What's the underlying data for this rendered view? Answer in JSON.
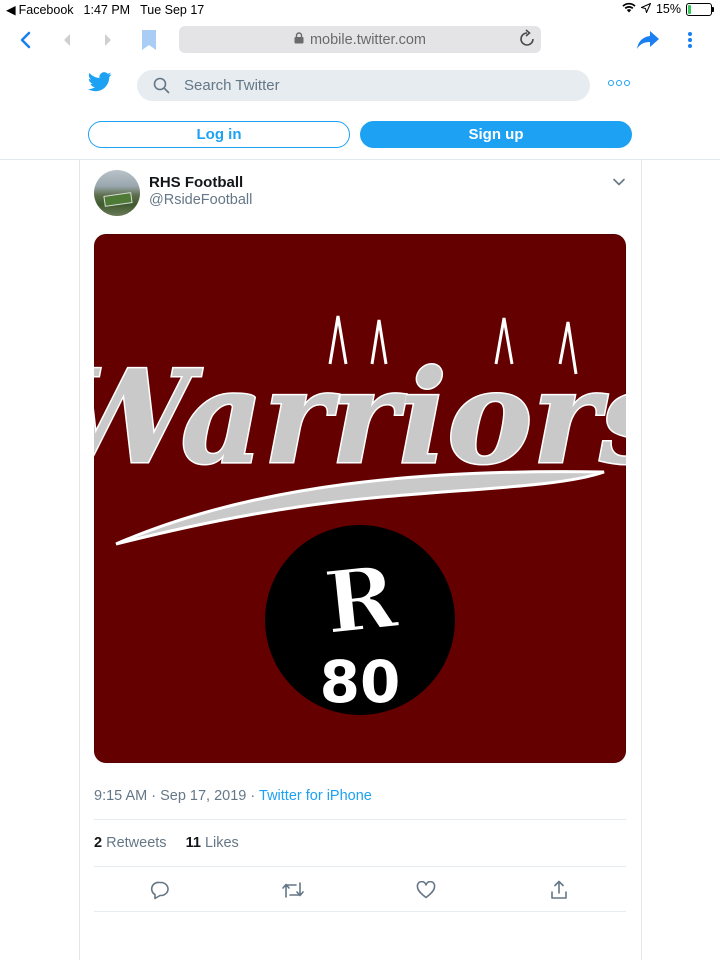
{
  "status_bar": {
    "back_app": "Facebook",
    "time": "1:47 PM",
    "date": "Tue Sep 17",
    "battery": "15%",
    "battery_level": 0.15
  },
  "browser": {
    "url": "mobile.twitter.com",
    "icons": [
      "back-icon",
      "prev-icon",
      "next-icon",
      "bookmark-icon",
      "lock-icon",
      "reload-icon",
      "share-icon",
      "more-vertical-icon"
    ]
  },
  "header": {
    "search_placeholder": "Search Twitter",
    "login_label": "Log in",
    "signup_label": "Sign up"
  },
  "tweet": {
    "display_name": "RHS Football",
    "handle": "@RsideFootball",
    "media": {
      "wordmark": "Warriors",
      "logo_letter": "R",
      "logo_number": "80",
      "colors": {
        "background": "#650000",
        "silver": "#c9c9c9",
        "circle": "#000000"
      }
    },
    "time": "9:15 AM",
    "date": "Sep 17, 2019",
    "source": "Twitter for iPhone",
    "retweet_count": "2",
    "retweet_label": "Retweets",
    "like_count": "11",
    "like_label": "Likes"
  },
  "colors": {
    "accent": "#1da1f2",
    "text_secondary": "#657786",
    "border": "#e1e8ed"
  }
}
